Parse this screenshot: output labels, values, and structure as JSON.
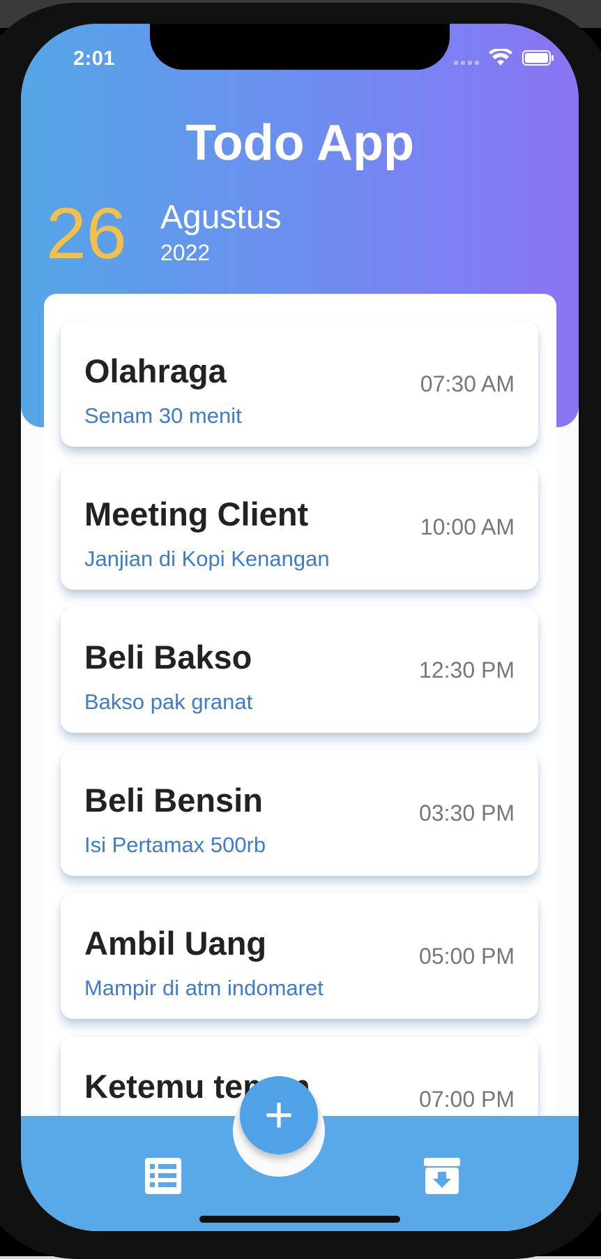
{
  "status_bar": {
    "time": "2:01"
  },
  "header": {
    "title": "Todo App",
    "day": "26",
    "month": "Agustus",
    "year": "2022"
  },
  "todos": [
    {
      "title": "Olahraga",
      "subtitle": "Senam 30 menit",
      "time": "07:30 AM"
    },
    {
      "title": "Meeting Client",
      "subtitle": "Janjian di Kopi Kenangan",
      "time": "10:00 AM"
    },
    {
      "title": "Beli Bakso",
      "subtitle": "Bakso pak granat",
      "time": "12:30 PM"
    },
    {
      "title": "Beli Bensin",
      "subtitle": "Isi Pertamax 500rb",
      "time": "03:30 PM"
    },
    {
      "title": "Ambil Uang",
      "subtitle": "Mampir di atm indomaret",
      "time": "05:00 PM"
    },
    {
      "title": "Ketemu teman",
      "subtitle": "",
      "time": "07:00 PM"
    }
  ],
  "bottom_nav": {
    "left_icon": "list-icon",
    "fab_label": "+",
    "right_icon": "archive-icon"
  },
  "colors": {
    "header_gradient_start": "#55a6e6",
    "header_gradient_end": "#8a74f3",
    "day_accent": "#f3c04a",
    "subtitle": "#3d7cc9",
    "bottom_bar": "#59a8e8"
  }
}
